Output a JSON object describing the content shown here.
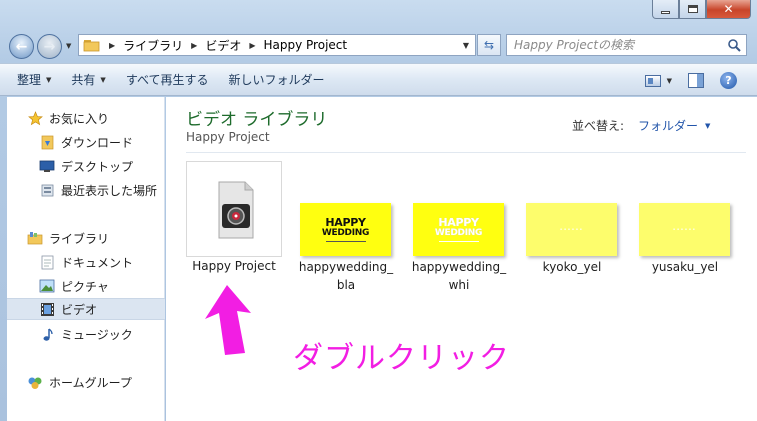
{
  "window": {
    "close_symbol": "✕",
    "accent": "#1e6b2c"
  },
  "address": {
    "crumbs": [
      "ライブラリ",
      "ビデオ",
      "Happy Project"
    ],
    "search_placeholder": "Happy Projectの検索"
  },
  "toolbar": {
    "organize": "整理",
    "share": "共有",
    "play_all": "すべて再生する",
    "new_folder": "新しいフォルダー"
  },
  "navpane": {
    "favorites": "お気に入り",
    "downloads": "ダウンロード",
    "desktop": "デスクトップ",
    "recent": "最近表示した場所",
    "libraries": "ライブラリ",
    "documents": "ドキュメント",
    "pictures": "ピクチャ",
    "videos": "ビデオ",
    "music": "ミュージック",
    "homegroup": "ホームグループ"
  },
  "content": {
    "library_title": "ビデオ ライブラリ",
    "library_subtitle": "Happy Project",
    "sort_label": "並べ替え:",
    "sort_value": "フォルダー",
    "files": [
      {
        "line1": "Happy Project",
        "line2": ""
      },
      {
        "line1": "happywedding_",
        "line2": "bla"
      },
      {
        "line1": "happywedding_",
        "line2": "whi"
      },
      {
        "line1": "kyoko_yel",
        "line2": ""
      },
      {
        "line1": "yusaku_yel",
        "line2": ""
      }
    ],
    "thumb_text_1": "HAPPY",
    "thumb_text_2": "WEDDING"
  },
  "annotation": {
    "text": "ダブルクリック",
    "color": "#f21ee3"
  }
}
